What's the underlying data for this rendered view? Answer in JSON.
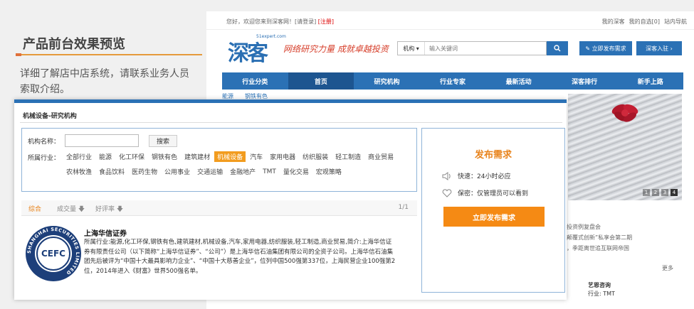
{
  "promo": {
    "title": "产品前台效果预览",
    "description": "详细了解店中店系统，请联系业务人员索取介绍。"
  },
  "site": {
    "topbar": {
      "welcome": "您好，欢迎您来到深客网！",
      "login": "[请登录]",
      "register": "[注册]",
      "links": [
        "我的深客",
        "我的自选[0]",
        "站内导航"
      ]
    },
    "logo": {
      "mark": "深客",
      "domain": "51expert.com"
    },
    "slogan": "网络研究力量 成就卓越投资",
    "search": {
      "scope": "机构",
      "placeholder": "输入关键词"
    },
    "buttons": {
      "publish": "立即发布需求",
      "join": "深客入驻"
    },
    "nav": [
      "行业分类",
      "首页",
      "研究机构",
      "行业专家",
      "最新活动",
      "深客排行",
      "新手上路"
    ],
    "category_peek": "能源　　钢铁有色",
    "banner_pages": [
      "1",
      "2",
      "3",
      "4"
    ],
    "news": [
      "投资例复盘会",
      "颠覆式创新”私享会第二期",
      "，季距离世追互联网帝国"
    ],
    "more": "更多",
    "side_org": {
      "name": "艺恩咨询",
      "industry": "行业: TMT"
    }
  },
  "panel": {
    "title": "机械设备-研究机构",
    "filter": {
      "name_label": "机构名称：",
      "name_value": "",
      "search_button": "搜索",
      "industry_label": "所属行业：",
      "tags": [
        "全部行业",
        "能源",
        "化工环保",
        "钢铁有色",
        "建筑建材",
        "机械设备",
        "汽车",
        "家用电器",
        "纺织服装",
        "轻工制造",
        "商业贸易",
        "农林牧渔",
        "食品饮料",
        "医药生物",
        "公用事业",
        "交通运输",
        "金融地产",
        "TMT",
        "量化交易",
        "宏观策略"
      ],
      "active_tag": "机械设备"
    },
    "sort": {
      "overall": "综合",
      "volume": "成交量",
      "rating": "好评率",
      "page": "1/1"
    },
    "org": {
      "name": "上海华信证券",
      "logo_text": "SHANGHAI SECURITIES LIMITED",
      "logo_mark": "CEFC",
      "description": "所属行业:能源,化工环保,钢铁有色,建筑建材,机械设备,汽车,家用电器,纺织服装,轻工制造,商业贸易,简介:上海华信证券有限责任公司（以下简称“上海华信证券”、“公司”）是上海华信石油集团有限公司的全资子公司。上海华信石油集团先后被评为“中国十大最具影响力企业”、“中国十大慈善企业”，位列中国500强第337位，上海民营企业100强第2位，2014年进入《财富》世界500强名单。"
    },
    "publish": {
      "title": "发布需求",
      "fast": "快速：24小时必应",
      "secret": "保密：仅管理员可以看到",
      "button": "立即发布需求"
    }
  },
  "colors": {
    "primary": "#2b71b5",
    "accent": "#f58a14",
    "active_tag": "#f29c1f"
  }
}
